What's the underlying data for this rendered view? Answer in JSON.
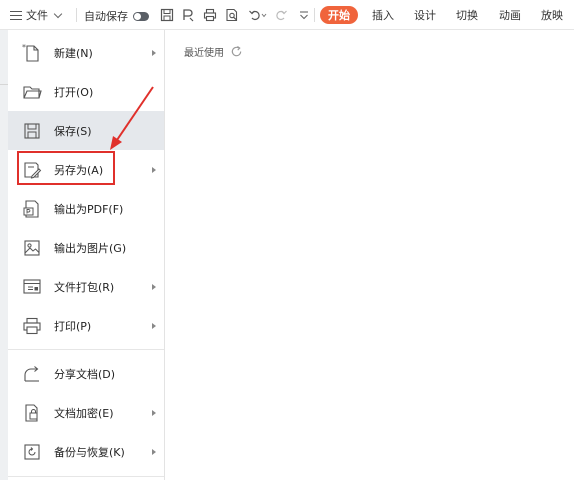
{
  "toolbar": {
    "file_label": "文件",
    "autosave_label": "自动保存",
    "tabs": [
      "开始",
      "插入",
      "设计",
      "切换",
      "动画",
      "放映"
    ]
  },
  "menu": {
    "items": [
      {
        "label": "新建(N)",
        "icon": "new-file-icon",
        "submenu": true
      },
      {
        "label": "打开(O)",
        "icon": "folder-icon",
        "submenu": false
      },
      {
        "label": "保存(S)",
        "icon": "save-icon",
        "submenu": false
      },
      {
        "label": "另存为(A)",
        "icon": "save-as-icon",
        "submenu": true
      },
      {
        "label": "输出为PDF(F)",
        "icon": "pdf-export-icon",
        "submenu": false
      },
      {
        "label": "输出为图片(G)",
        "icon": "image-export-icon",
        "submenu": false
      },
      {
        "label": "文件打包(R)",
        "icon": "package-icon",
        "submenu": true
      },
      {
        "label": "打印(P)",
        "icon": "print-icon",
        "submenu": true
      },
      {
        "label": "分享文档(D)",
        "icon": "share-icon",
        "submenu": false
      },
      {
        "label": "文档加密(E)",
        "icon": "lock-document-icon",
        "submenu": true
      },
      {
        "label": "备份与恢复(K)",
        "icon": "backup-icon",
        "submenu": true
      }
    ],
    "selected_index": 2
  },
  "recent": {
    "title": "最近使用"
  },
  "colors": {
    "accent": "#f0643c",
    "annotation": "#e0302b",
    "selected_bg": "#e5e8ec"
  }
}
